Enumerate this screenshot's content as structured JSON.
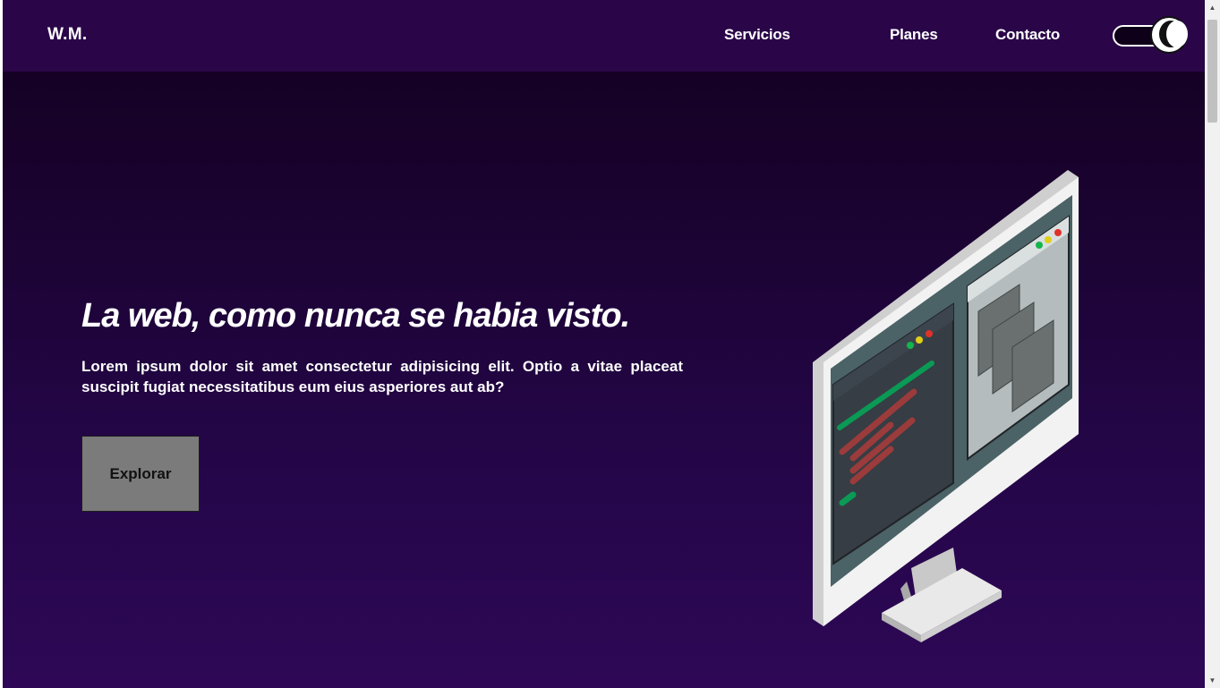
{
  "header": {
    "brand": "W.M.",
    "nav": [
      {
        "label": "Servicios"
      },
      {
        "label": "Planes"
      },
      {
        "label": "Contacto"
      }
    ],
    "theme_toggle": {
      "icon": "moon-icon",
      "state": "dark"
    }
  },
  "hero": {
    "title": "La web, como nunca se habia visto.",
    "text": "Lorem ipsum dolor sit amet consectetur adipisicing elit. Optio a vitae placeat suscipit fugiat necessitatibus eum eius asperiores aut ab?",
    "button_label": "Explorar",
    "illustration": "isometric-monitor-illustration"
  },
  "colors": {
    "navbar": "#2a0649",
    "background_top": "#13001f",
    "background_bottom": "#2e0856",
    "button": "#7b7b7b",
    "code_green": "#0a9a55",
    "code_red": "#9b3b3b"
  },
  "scrollbar": {
    "up_icon": "scroll-up-arrow-icon",
    "down_icon": "scroll-down-arrow-icon"
  }
}
